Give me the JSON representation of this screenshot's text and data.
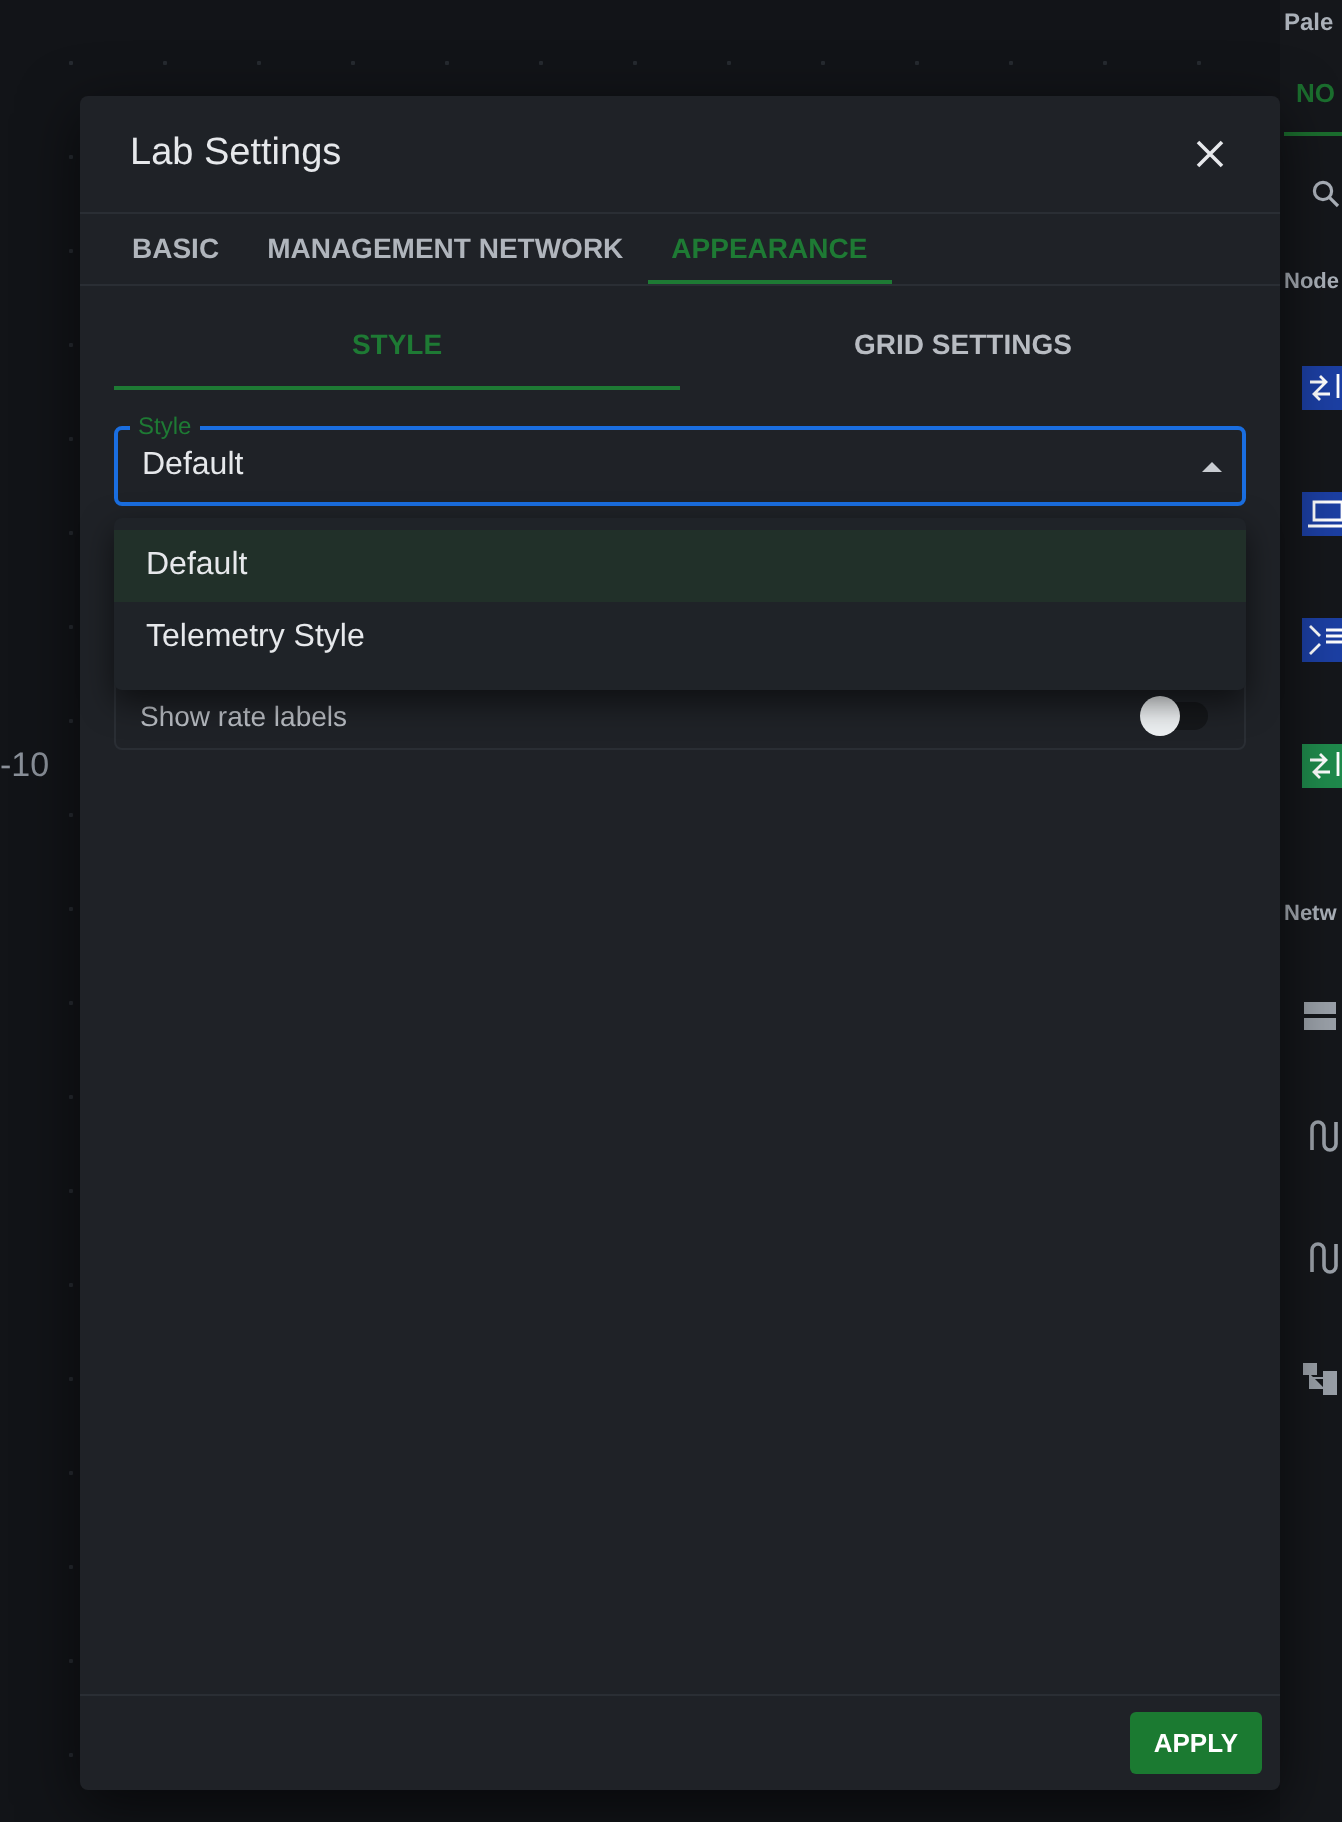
{
  "canvas": {
    "axis_label": "-10"
  },
  "palette": {
    "title": "Pale",
    "tabs": [
      {
        "label": "NO",
        "selected": true
      }
    ],
    "sections": [
      {
        "title": "Node",
        "items": [
          {
            "kind": "switch",
            "color": "#1c3fa3"
          },
          {
            "kind": "laptop",
            "color": "#1c3fa3"
          },
          {
            "kind": "router",
            "color": "#1c3fa3"
          },
          {
            "kind": "switch",
            "color": "#1f8a4c"
          }
        ]
      },
      {
        "title": "Netw",
        "items": [
          {
            "kind": "server"
          },
          {
            "kind": "link"
          },
          {
            "kind": "link"
          },
          {
            "kind": "tree"
          }
        ]
      }
    ]
  },
  "dialog": {
    "title": "Lab Settings",
    "tabs": [
      {
        "label": "BASIC",
        "selected": false
      },
      {
        "label": "MANAGEMENT NETWORK",
        "selected": false
      },
      {
        "label": "APPEARANCE",
        "selected": true
      }
    ],
    "subtabs": [
      {
        "label": "STYLE",
        "selected": true
      },
      {
        "label": "GRID SETTINGS",
        "selected": false
      }
    ],
    "select": {
      "label": "Style",
      "value": "Default",
      "open": true
    },
    "options": [
      {
        "label": "Default",
        "selected": true
      },
      {
        "label": "Telemetry Style",
        "selected": false
      }
    ],
    "settings": [
      {
        "kind": "toggle",
        "label": "Show rate labels",
        "on": false
      }
    ],
    "buttons": [
      {
        "label": "APPLY"
      }
    ]
  }
}
